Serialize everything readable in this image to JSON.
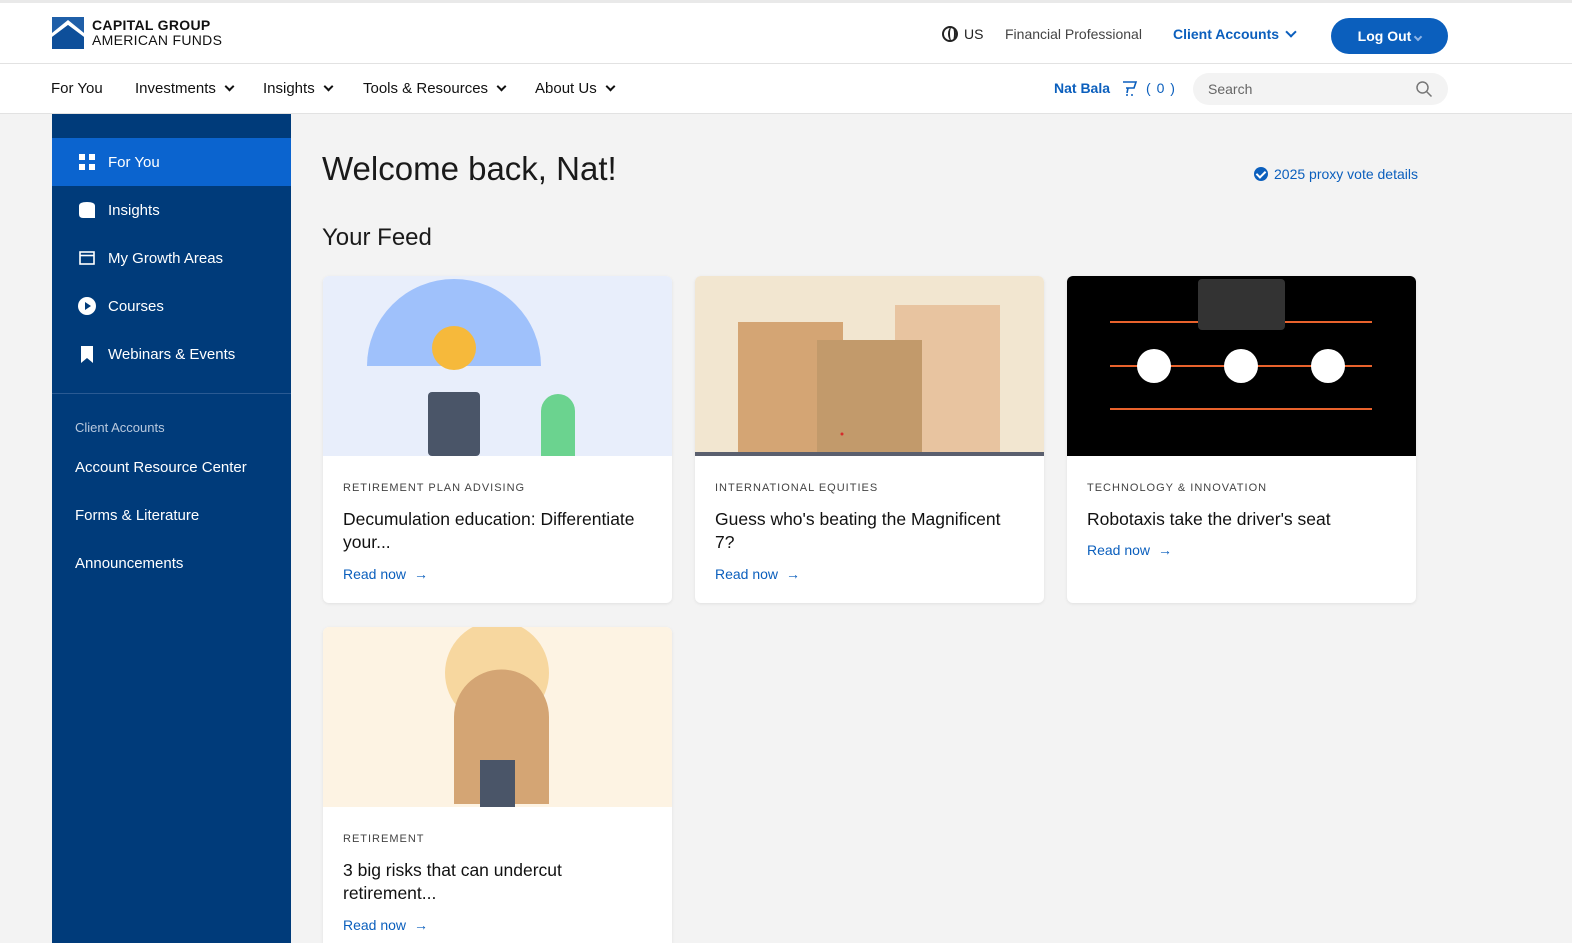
{
  "brand": {
    "line1": "CAPITAL GROUP",
    "line2": "AMERICAN FUNDS"
  },
  "header": {
    "region": "US",
    "role": "Financial Professional",
    "client_accounts": "Client Accounts",
    "logout": "Log Out"
  },
  "nav": {
    "items": [
      {
        "label": "For You"
      },
      {
        "label": "Investments"
      },
      {
        "label": "Insights"
      },
      {
        "label": "Tools & Resources"
      },
      {
        "label": "About Us"
      }
    ],
    "user": "Nat Bala",
    "cart_count": "( 0 )",
    "search_placeholder": "Search"
  },
  "sidebar": {
    "items": [
      {
        "label": "For You",
        "icon": "grid-icon",
        "active": true
      },
      {
        "label": "Insights",
        "icon": "insights-icon"
      },
      {
        "label": "My Growth Areas",
        "icon": "window-icon"
      },
      {
        "label": "Courses",
        "icon": "play-icon"
      },
      {
        "label": "Webinars & Events",
        "icon": "bookmark-icon"
      }
    ],
    "section_heading": "Client Accounts",
    "links": [
      {
        "label": "Account Resource Center"
      },
      {
        "label": "Forms & Literature"
      },
      {
        "label": "Announcements"
      }
    ]
  },
  "main": {
    "welcome": "Welcome back, Nat!",
    "proxy_link": "2025 proxy vote details",
    "feed_title": "Your Feed",
    "cards": [
      {
        "category": "RETIREMENT PLAN ADVISING",
        "title": "Decumulation education: Differentiate your...",
        "cta": "Read now"
      },
      {
        "category": "INTERNATIONAL EQUITIES",
        "title": "Guess who's beating the Magnificent 7?",
        "cta": "Read now"
      },
      {
        "category": "TECHNOLOGY & INNOVATION",
        "title": "Robotaxis take the driver's seat",
        "cta": "Read now"
      },
      {
        "category": "RETIREMENT",
        "title": "3 big risks that can undercut retirement...",
        "cta": "Read now"
      }
    ]
  },
  "colors": {
    "accent": "#0b5fbd",
    "sidebar": "#003b7a",
    "sidebar_active": "#0b64cf"
  }
}
